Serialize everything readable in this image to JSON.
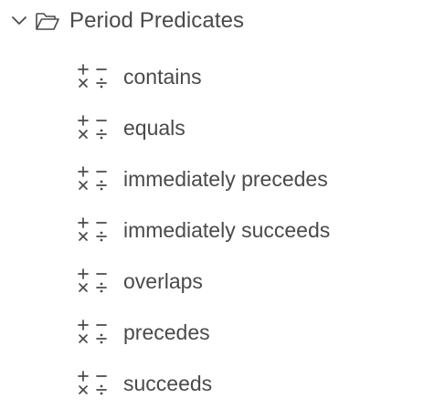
{
  "folder": {
    "label": "Period Predicates",
    "expanded": true,
    "icons": {
      "toggle": "chevron-down-icon",
      "folder": "folder-open-icon"
    }
  },
  "items": [
    {
      "label": "contains",
      "icon": "operators-icon"
    },
    {
      "label": "equals",
      "icon": "operators-icon"
    },
    {
      "label": "immediately precedes",
      "icon": "operators-icon"
    },
    {
      "label": "immediately succeeds",
      "icon": "operators-icon"
    },
    {
      "label": "overlaps",
      "icon": "operators-icon"
    },
    {
      "label": "precedes",
      "icon": "operators-icon"
    },
    {
      "label": "succeeds",
      "icon": "operators-icon"
    }
  ],
  "colors": {
    "text": "#4a4a4a",
    "icon": "#4a4a4a",
    "background": "#ffffff"
  }
}
